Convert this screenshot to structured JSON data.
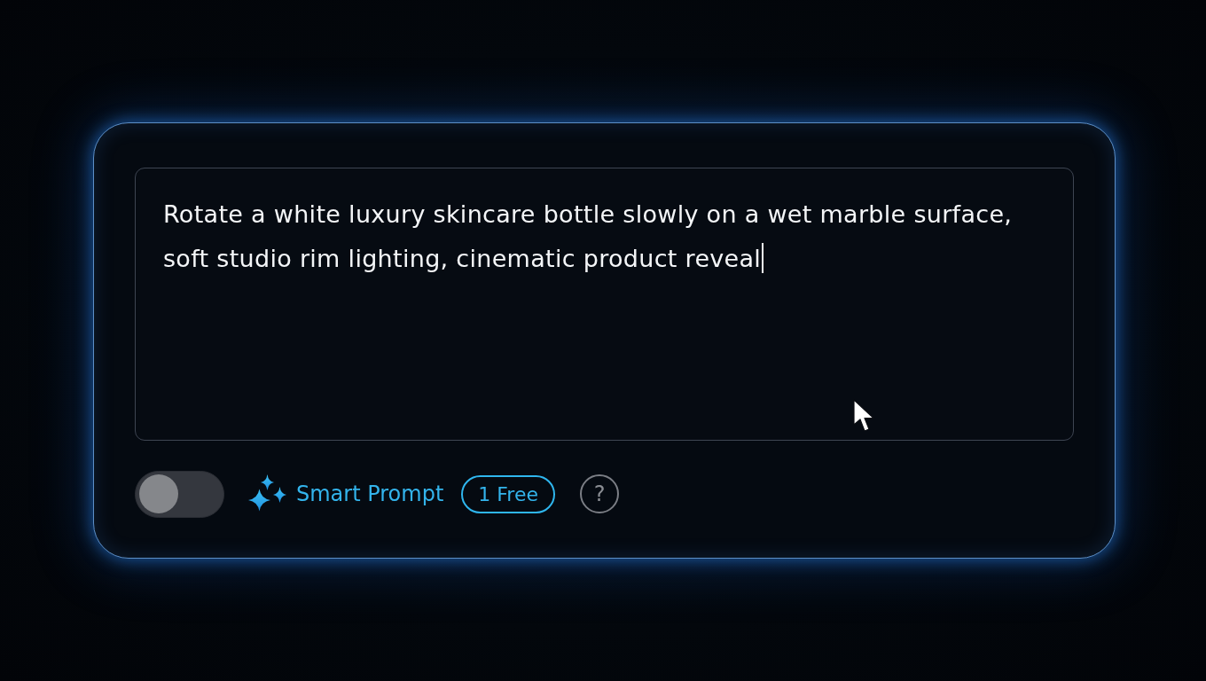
{
  "prompt_field": {
    "value": "Rotate a white luxury skincare bottle slowly on a wet marble surface, soft studio rim lighting, cinematic product reveal",
    "focused": true
  },
  "smart_prompt": {
    "on": false,
    "label": "Smart Prompt",
    "badge": "1 Free"
  },
  "help_button": {
    "label": "?"
  }
}
